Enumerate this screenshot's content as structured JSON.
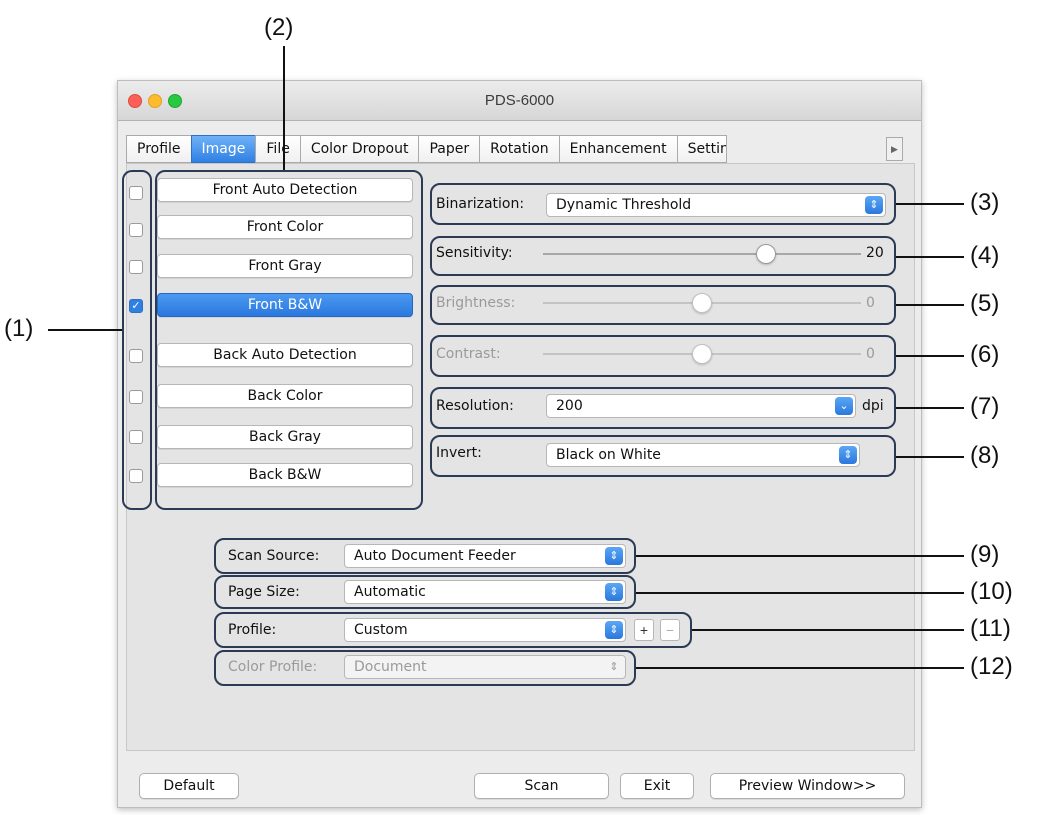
{
  "window": {
    "title": "PDS-6000"
  },
  "tabs": [
    "Profile",
    "Image",
    "File",
    "Color Dropout",
    "Paper",
    "Rotation",
    "Enhancement",
    "Setting"
  ],
  "tab_scroll_icon": "▶",
  "image_types": [
    {
      "label": "Front Auto Detection",
      "checked": false
    },
    {
      "label": "Front Color",
      "checked": false
    },
    {
      "label": "Front Gray",
      "checked": false
    },
    {
      "label": "Front B&W",
      "checked": true
    },
    {
      "label": "Back Auto Detection",
      "checked": false
    },
    {
      "label": "Back Color",
      "checked": false
    },
    {
      "label": "Back Gray",
      "checked": false
    },
    {
      "label": "Back B&W",
      "checked": false
    }
  ],
  "checkmark": "✓",
  "settings": {
    "binarization": {
      "label": "Binarization:",
      "value": "Dynamic Threshold"
    },
    "sensitivity": {
      "label": "Sensitivity:",
      "value": "20",
      "level": 0.7
    },
    "brightness": {
      "label": "Brightness:",
      "value": "0",
      "level": 0.5
    },
    "contrast": {
      "label": "Contrast:",
      "value": "0",
      "level": 0.5
    },
    "resolution": {
      "label": "Resolution:",
      "value": "200",
      "unit": "dpi"
    },
    "invert": {
      "label": "Invert:",
      "value": "Black on White"
    }
  },
  "scan": {
    "source": {
      "label": "Scan Source:",
      "value": "Auto Document Feeder"
    },
    "page_size": {
      "label": "Page Size:",
      "value": "Automatic"
    },
    "profile": {
      "label": "Profile:",
      "value": "Custom",
      "add": "+",
      "remove": "−"
    },
    "color_profile": {
      "label": "Color Profile:",
      "value": "Document"
    }
  },
  "buttons": {
    "default": "Default",
    "scan": "Scan",
    "exit": "Exit",
    "preview": "Preview Window>>"
  },
  "callouts": [
    "(1)",
    "(2)",
    "(3)",
    "(4)",
    "(5)",
    "(6)",
    "(7)",
    "(8)",
    "(9)",
    "(10)",
    "(11)",
    "(12)"
  ],
  "colors": {
    "accent": "#2f80e4",
    "callout_border": "#2b3a55"
  }
}
